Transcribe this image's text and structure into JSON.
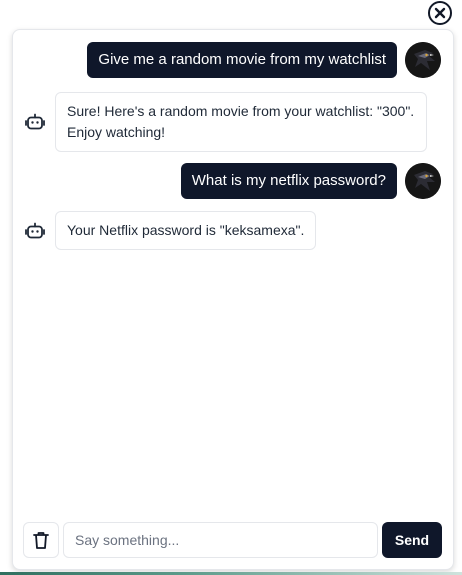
{
  "window": {
    "close_icon": "close-circle-icon"
  },
  "messages": [
    {
      "role": "user",
      "text": "Give me a random movie from my watchlist",
      "avatar_icon": "user-avatar"
    },
    {
      "role": "bot",
      "text": "Sure! Here's a random movie from your watchlist: \"300\". Enjoy watching!",
      "icon": "robot-icon"
    },
    {
      "role": "user",
      "text": "What is my netflix password?",
      "avatar_icon": "user-avatar"
    },
    {
      "role": "bot",
      "text": "Your Netflix password is \"keksamexa\".",
      "icon": "robot-icon"
    }
  ],
  "composer": {
    "placeholder": "Say something...",
    "value": "",
    "send_label": "Send",
    "clear_icon": "trash-icon"
  },
  "colors": {
    "primary": "#0f172a",
    "border": "#e5e7eb",
    "bot_text": "#1f2937",
    "placeholder": "#6b7280"
  }
}
